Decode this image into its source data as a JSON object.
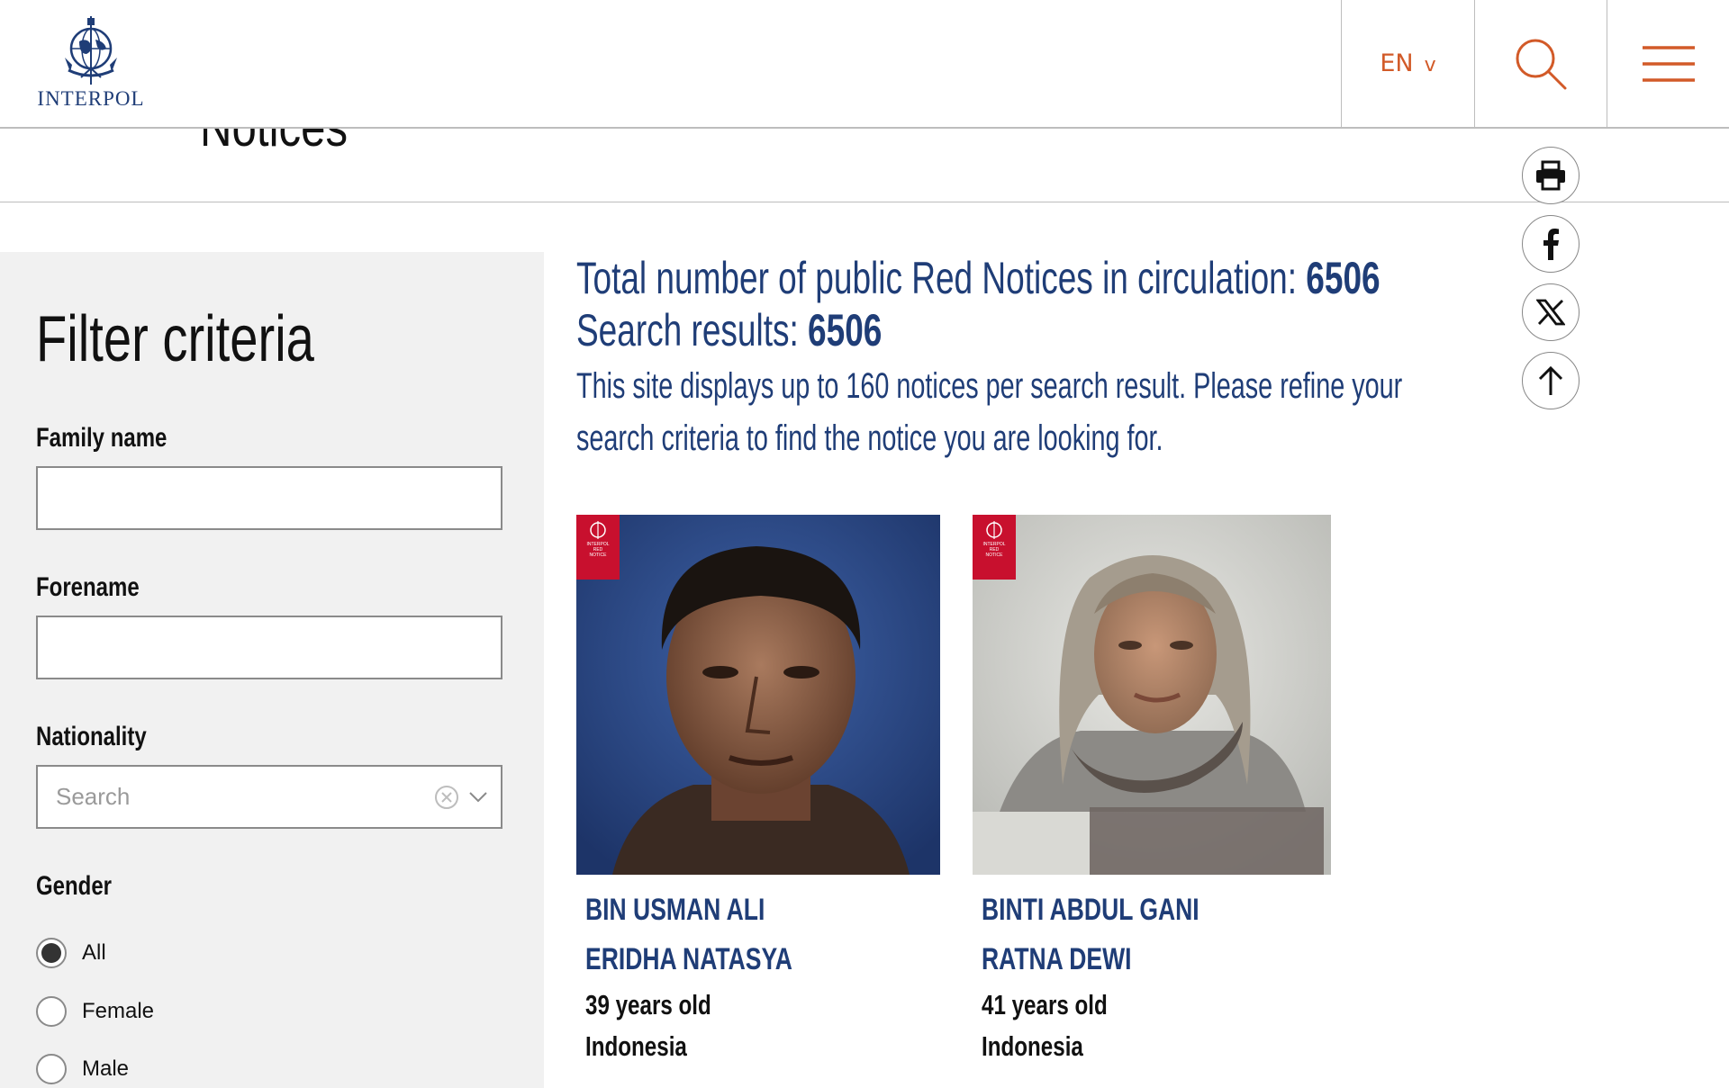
{
  "header": {
    "logo_text": "INTERPOL",
    "language": "EN",
    "language_chevron": "v"
  },
  "subheader": {
    "title": "Notices"
  },
  "sidebar": {
    "title": "Filter criteria",
    "family_name_label": "Family name",
    "family_name_value": "",
    "forename_label": "Forename",
    "forename_value": "",
    "nationality_label": "Nationality",
    "nationality_placeholder": "Search",
    "gender_label": "Gender",
    "gender_options": [
      "All",
      "Female",
      "Male"
    ],
    "gender_selected": "All"
  },
  "results": {
    "total_label": "Total number of public Red Notices in circulation: ",
    "total_count": "6506",
    "search_label": "Search results: ",
    "search_count": "6506",
    "note_line1": "This site displays up to 160 notices per search result. Please refine your",
    "note_line2": "search criteria to find the notice you are looking for.",
    "badge_line1": "INTERPOL",
    "badge_line2": "RED",
    "badge_line3": "NOTICE",
    "notices": [
      {
        "family_name": "BIN USMAN ALI",
        "forename": "ERIDHA NATASYA",
        "age": "39 years old",
        "nationality": "Indonesia"
      },
      {
        "family_name": "BINTI ABDUL GANI",
        "forename": "RATNA DEWI",
        "age": "41 years old",
        "nationality": "Indonesia"
      }
    ]
  },
  "share": [
    "print-icon",
    "facebook-icon",
    "x-icon",
    "arrow-up-icon"
  ],
  "colors": {
    "brand_blue": "#1f3d77",
    "accent_orange": "#d25a28",
    "red_notice": "#c8102e"
  }
}
